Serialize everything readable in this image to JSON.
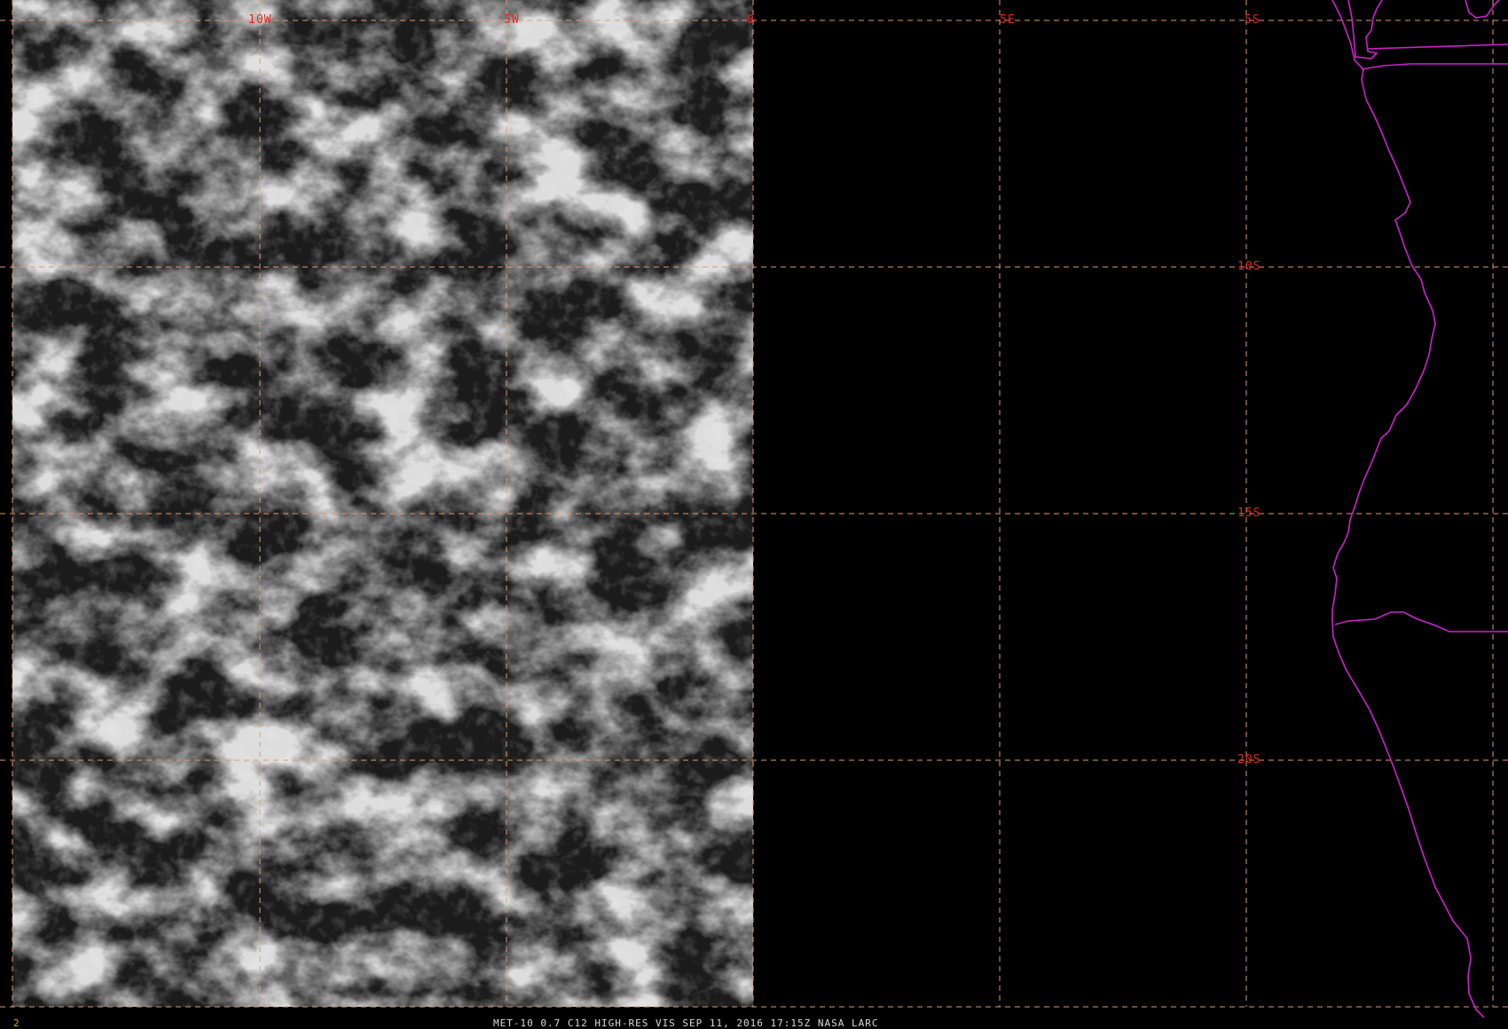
{
  "map": {
    "grid_lon_labels": [
      "10W",
      "5W",
      "0",
      "5E"
    ],
    "grid_lat_labels": [
      "5S",
      "10S",
      "15S",
      "20S"
    ],
    "colors": {
      "grid": "#e09a72",
      "grid_label": "#e0281e",
      "boundary": "#cc22cc",
      "background": "#000000"
    }
  },
  "status_bar": {
    "frame_number": "2",
    "frame_number_color": "#d4b000",
    "caption": "MET-10 0.7 C12 HIGH-RES VIS   SEP 11, 2016 17:15Z   NASA LARC",
    "caption_color": "#d8d8d8"
  }
}
